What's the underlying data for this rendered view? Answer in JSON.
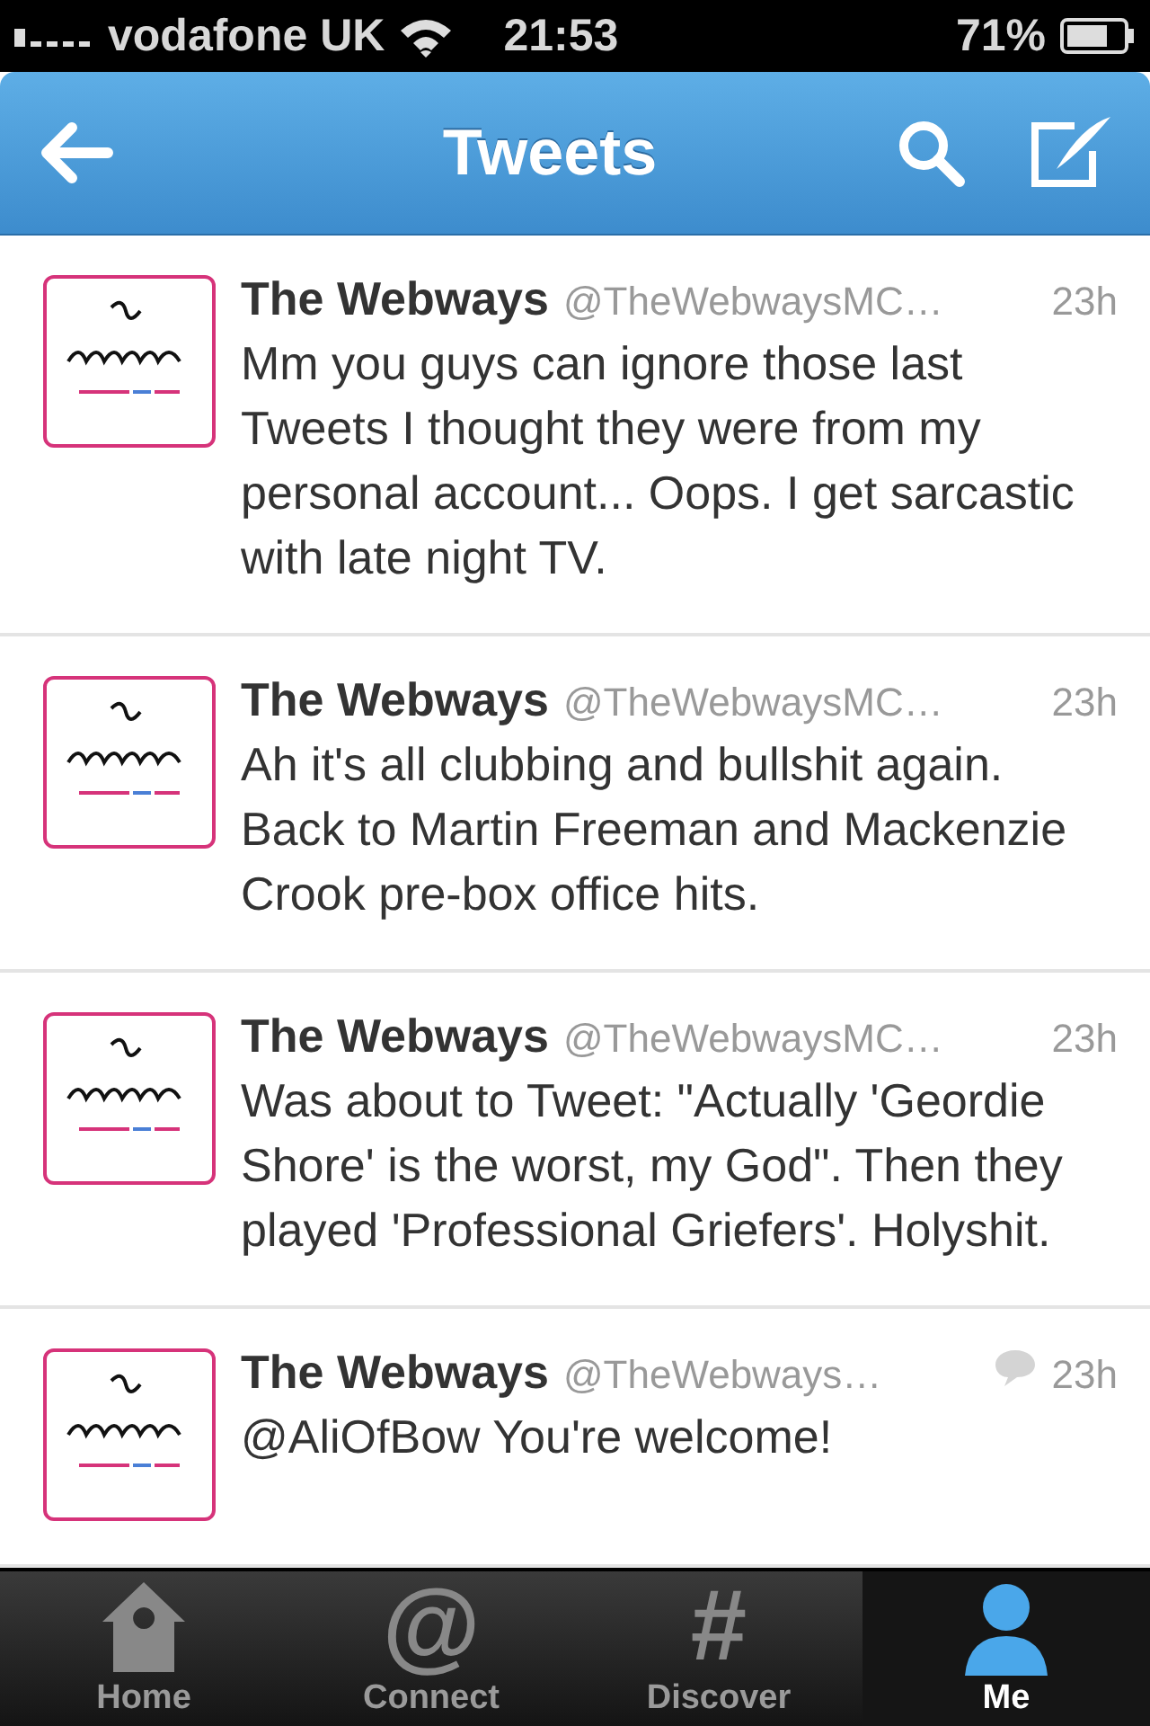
{
  "status_bar": {
    "carrier": "vodafone UK",
    "time": "21:53",
    "battery": "71%"
  },
  "nav": {
    "title": "Tweets"
  },
  "tweets": [
    {
      "name": "The Webways",
      "handle": "@TheWebwaysMC…",
      "time": "23h",
      "conversation": false,
      "text": "Mm you guys can ignore those last Tweets I thought they were from my personal account... Oops. I get sarcastic with late night TV."
    },
    {
      "name": "The Webways",
      "handle": "@TheWebwaysMC…",
      "time": "23h",
      "conversation": false,
      "text": "Ah it's all clubbing and bullshit again. Back to Martin Freeman and Mackenzie Crook pre-box office hits."
    },
    {
      "name": "The Webways",
      "handle": "@TheWebwaysMC…",
      "time": "23h",
      "conversation": false,
      "text": "Was about to Tweet: \"Actually 'Geordie Shore' is the worst, my God\". Then they played 'Professional Griefers'. Holyshit."
    },
    {
      "name": "The Webways",
      "handle": "@TheWebways…",
      "time": "23h",
      "conversation": true,
      "text": "@AliOfBow You're welcome!"
    }
  ],
  "tab_bar": [
    {
      "label": "Home",
      "kind": "home",
      "selected": false
    },
    {
      "label": "Connect",
      "kind": "connect",
      "glyph": "@",
      "selected": false
    },
    {
      "label": "Discover",
      "kind": "discover",
      "glyph": "#",
      "selected": false
    },
    {
      "label": "Me",
      "kind": "me",
      "selected": true
    }
  ]
}
